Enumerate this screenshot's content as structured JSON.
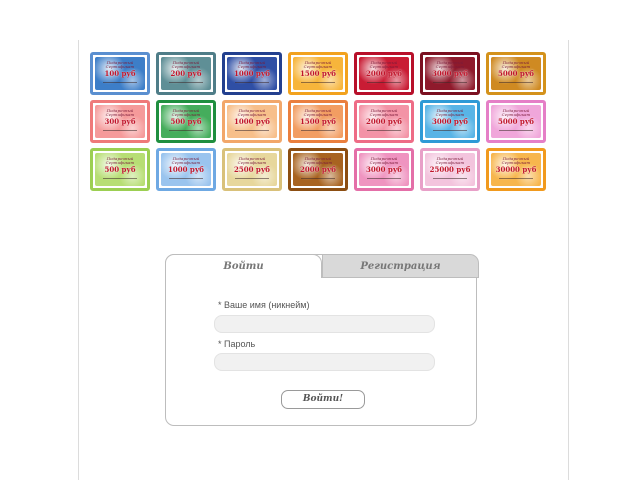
{
  "certificates": {
    "title_text": "Подарочный Сертификат",
    "currency": "руб",
    "rows": [
      [
        {
          "value": "100",
          "border": "#5a8fd0",
          "bg": "#3d7ec8"
        },
        {
          "value": "200",
          "border": "#4f7d88",
          "bg": "#5f8f96"
        },
        {
          "value": "1000",
          "border": "#23408f",
          "bg": "#2f4fa5"
        },
        {
          "value": "1500",
          "border": "#f2a21e",
          "bg": "#f7b53b"
        },
        {
          "value": "2000",
          "border": "#b8102a",
          "bg": "#c91c34"
        },
        {
          "value": "3000",
          "border": "#7b1020",
          "bg": "#8f1a2c"
        },
        {
          "value": "5000",
          "border": "#d4921b",
          "bg": "#cf8a22"
        }
      ],
      [
        {
          "value": "300",
          "border": "#ef7a7a",
          "bg": "#f59a9a"
        },
        {
          "value": "500",
          "border": "#1f8f3f",
          "bg": "#45ad5c"
        },
        {
          "value": "1000",
          "border": "#f2a76a",
          "bg": "#f7bf8a"
        },
        {
          "value": "1500",
          "border": "#ea7f3e",
          "bg": "#f29d62"
        },
        {
          "value": "2000",
          "border": "#ee6c86",
          "bg": "#f393a6"
        },
        {
          "value": "3000",
          "border": "#2e9ad6",
          "bg": "#58b4e6"
        },
        {
          "value": "5000",
          "border": "#e57fc7",
          "bg": "#f0a6da"
        }
      ],
      [
        {
          "value": "500",
          "border": "#9ccf52",
          "bg": "#b7de74"
        },
        {
          "value": "1000",
          "border": "#6fa9e3",
          "bg": "#9ac4ee"
        },
        {
          "value": "2500",
          "border": "#d9c17a",
          "bg": "#e7d79c"
        },
        {
          "value": "2000",
          "border": "#8c4e12",
          "bg": "#a86320"
        },
        {
          "value": "3000",
          "border": "#e46fa8",
          "bg": "#ef94c0"
        },
        {
          "value": "25000",
          "border": "#e8a0c8",
          "bg": "#f3c4dd"
        },
        {
          "value": "30000",
          "border": "#f19a1e",
          "bg": "#f7b64d"
        }
      ]
    ]
  },
  "auth": {
    "tabs": {
      "login": "Войти",
      "register": "Регистрация"
    },
    "name_label": "* Ваше имя (никнейм)",
    "name_value": "",
    "name_placeholder": "",
    "password_label": "* Пароль",
    "password_value": "",
    "password_placeholder": "",
    "submit_label": "Войти!"
  }
}
